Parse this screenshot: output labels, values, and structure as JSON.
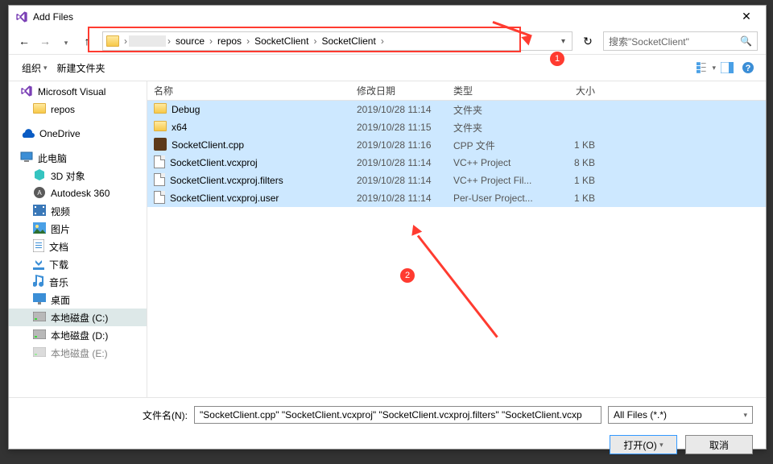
{
  "title": "Add Files",
  "breadcrumb": {
    "hidden_label": "",
    "items": [
      "source",
      "repos",
      "SocketClient",
      "SocketClient"
    ]
  },
  "search": {
    "placeholder": "搜索\"SocketClient\""
  },
  "toolbar": {
    "organize": "组织",
    "new_folder": "新建文件夹"
  },
  "tree": {
    "items": [
      {
        "label": "Microsoft Visual",
        "icon": "vs",
        "indent": false
      },
      {
        "label": "repos",
        "icon": "folder",
        "indent": true
      },
      {
        "label": "OneDrive",
        "icon": "onedrive",
        "indent": false,
        "gapBefore": true
      },
      {
        "label": "此电脑",
        "icon": "pc",
        "indent": false,
        "gapBefore": true
      },
      {
        "label": "3D 对象",
        "icon": "3d",
        "indent": true
      },
      {
        "label": "Autodesk 360",
        "icon": "a360",
        "indent": true
      },
      {
        "label": "视频",
        "icon": "video",
        "indent": true
      },
      {
        "label": "图片",
        "icon": "pictures",
        "indent": true
      },
      {
        "label": "文档",
        "icon": "docs",
        "indent": true
      },
      {
        "label": "下载",
        "icon": "downloads",
        "indent": true
      },
      {
        "label": "音乐",
        "icon": "music",
        "indent": true
      },
      {
        "label": "桌面",
        "icon": "desktop",
        "indent": true
      },
      {
        "label": "本地磁盘 (C:)",
        "icon": "disk",
        "indent": true,
        "selected": true
      },
      {
        "label": "本地磁盘 (D:)",
        "icon": "disk",
        "indent": true
      },
      {
        "label": "本地磁盘 (E:)",
        "icon": "disk",
        "indent": true,
        "cut": true
      }
    ]
  },
  "columns": {
    "name": "名称",
    "date": "修改日期",
    "type": "类型",
    "size": "大小"
  },
  "files": [
    {
      "name": "Debug",
      "date": "2019/10/28 11:14",
      "type": "文件夹",
      "size": "",
      "icon": "folder"
    },
    {
      "name": "x64",
      "date": "2019/10/28 11:15",
      "type": "文件夹",
      "size": "",
      "icon": "folder"
    },
    {
      "name": "SocketClient.cpp",
      "date": "2019/10/28 11:16",
      "type": "CPP 文件",
      "size": "1 KB",
      "icon": "cpp"
    },
    {
      "name": "SocketClient.vcxproj",
      "date": "2019/10/28 11:14",
      "type": "VC++ Project",
      "size": "8 KB",
      "icon": "proj"
    },
    {
      "name": "SocketClient.vcxproj.filters",
      "date": "2019/10/28 11:14",
      "type": "VC++ Project Fil...",
      "size": "1 KB",
      "icon": "proj"
    },
    {
      "name": "SocketClient.vcxproj.user",
      "date": "2019/10/28 11:14",
      "type": "Per-User Project...",
      "size": "1 KB",
      "icon": "proj"
    }
  ],
  "filename": {
    "label": "文件名(N):",
    "value": "\"SocketClient.cpp\" \"SocketClient.vcxproj\" \"SocketClient.vcxproj.filters\" \"SocketClient.vcxp"
  },
  "filetype": {
    "label": "All Files (*.*)"
  },
  "buttons": {
    "open": "打开(O)",
    "cancel": "取消"
  },
  "annotations": {
    "badge1": "1",
    "badge2": "2"
  }
}
